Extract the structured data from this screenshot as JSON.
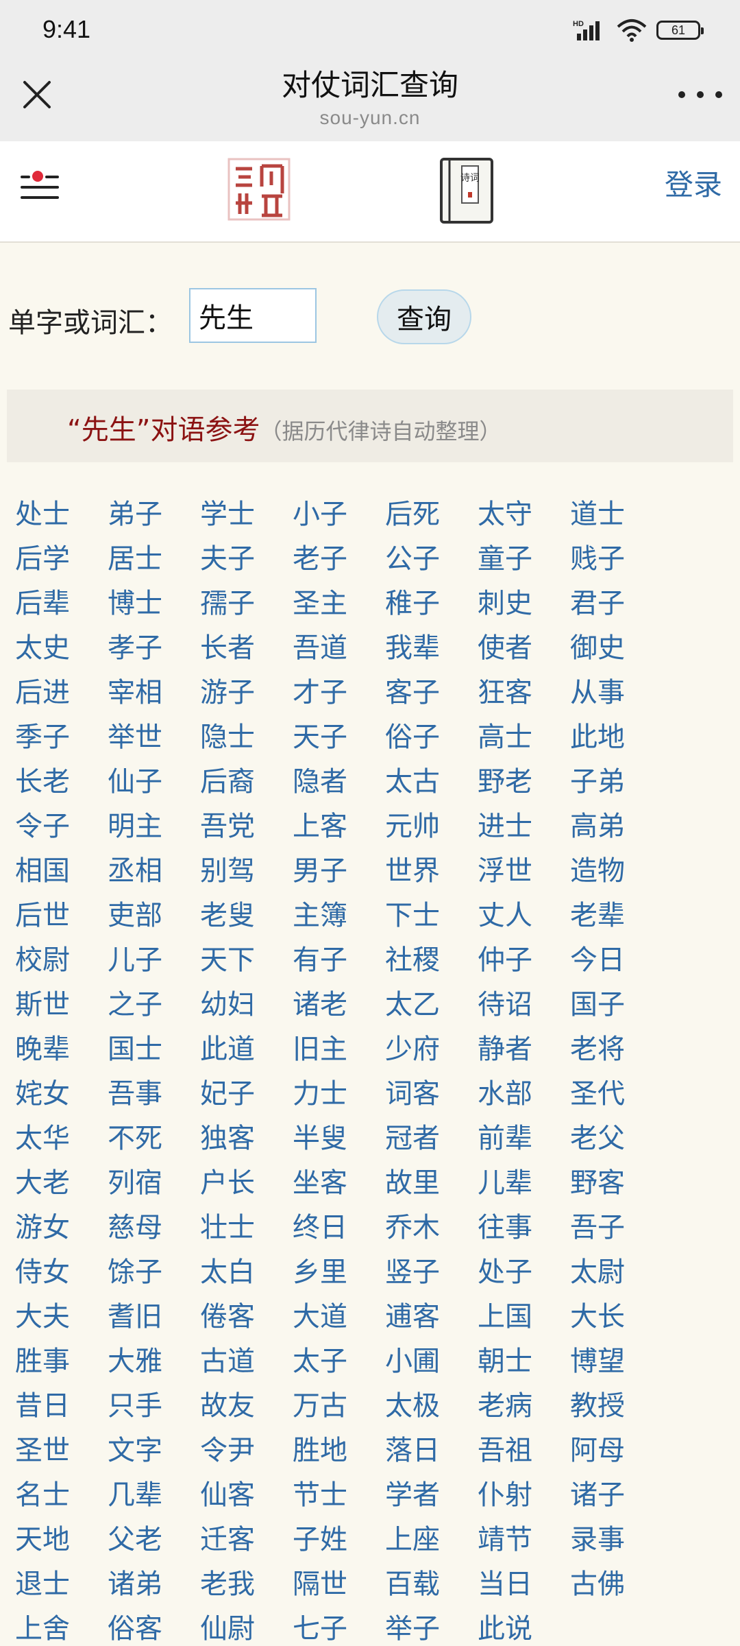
{
  "status_bar": {
    "time": "9:41",
    "battery": "61",
    "network_badge": "HD",
    "icons": [
      "signal-icon",
      "wifi-icon",
      "battery-icon"
    ]
  },
  "title_bar": {
    "title": "对仗词汇查询",
    "url": "sou-yun.cn",
    "icons": [
      "close-icon",
      "more-icon"
    ]
  },
  "site_header": {
    "login_label": "登录",
    "icons": [
      "menu-icon",
      "seal-logo-icon",
      "poetry-book-icon"
    ],
    "accent_dot_color": "#e02a3a",
    "book_label": "诗词"
  },
  "search": {
    "label": "单字或词汇：",
    "value": "先生",
    "button_label": "查询"
  },
  "result": {
    "term": "“先生”",
    "label": "对语参考",
    "note": "（据历代律诗自动整理）"
  },
  "words": [
    "处士",
    "弟子",
    "学士",
    "小子",
    "后死",
    "太守",
    "道士",
    "后学",
    "居士",
    "夫子",
    "老子",
    "公子",
    "童子",
    "贱子",
    "后辈",
    "博士",
    "孺子",
    "圣主",
    "稚子",
    "刺史",
    "君子",
    "太史",
    "孝子",
    "长者",
    "吾道",
    "我辈",
    "使者",
    "御史",
    "后进",
    "宰相",
    "游子",
    "才子",
    "客子",
    "狂客",
    "从事",
    "季子",
    "举世",
    "隐士",
    "天子",
    "俗子",
    "高士",
    "此地",
    "长老",
    "仙子",
    "后裔",
    "隐者",
    "太古",
    "野老",
    "子弟",
    "令子",
    "明主",
    "吾党",
    "上客",
    "元帅",
    "进士",
    "高弟",
    "相国",
    "丞相",
    "别驾",
    "男子",
    "世界",
    "浮世",
    "造物",
    "后世",
    "吏部",
    "老叟",
    "主簿",
    "下士",
    "丈人",
    "老辈",
    "校尉",
    "儿子",
    "天下",
    "有子",
    "社稷",
    "仲子",
    "今日",
    "斯世",
    "之子",
    "幼妇",
    "诸老",
    "太乙",
    "待诏",
    "国子",
    "晚辈",
    "国士",
    "此道",
    "旧主",
    "少府",
    "静者",
    "老将",
    "姹女",
    "吾事",
    "妃子",
    "力士",
    "词客",
    "水部",
    "圣代",
    "太华",
    "不死",
    "独客",
    "半叟",
    "冠者",
    "前辈",
    "老父",
    "大老",
    "列宿",
    "户长",
    "坐客",
    "故里",
    "儿辈",
    "野客",
    "游女",
    "慈母",
    "壮士",
    "终日",
    "乔木",
    "往事",
    "吾子",
    "侍女",
    "馀子",
    "太白",
    "乡里",
    "竖子",
    "处子",
    "太尉",
    "大夫",
    "耆旧",
    "倦客",
    "大道",
    "逋客",
    "上国",
    "大长",
    "胜事",
    "大雅",
    "古道",
    "太子",
    "小圃",
    "朝士",
    "博望",
    "昔日",
    "只手",
    "故友",
    "万古",
    "太极",
    "老病",
    "教授",
    "圣世",
    "文字",
    "令尹",
    "胜地",
    "落日",
    "吾祖",
    "阿母",
    "名士",
    "几辈",
    "仙客",
    "节士",
    "学者",
    "仆射",
    "诸子",
    "天地",
    "父老",
    "迁客",
    "子姓",
    "上座",
    "靖节",
    "录事",
    "退士",
    "诸弟",
    "老我",
    "隔世",
    "百载",
    "当日",
    "古佛",
    "上舍",
    "俗客",
    "仙尉",
    "七子",
    "举子",
    "此说"
  ]
}
